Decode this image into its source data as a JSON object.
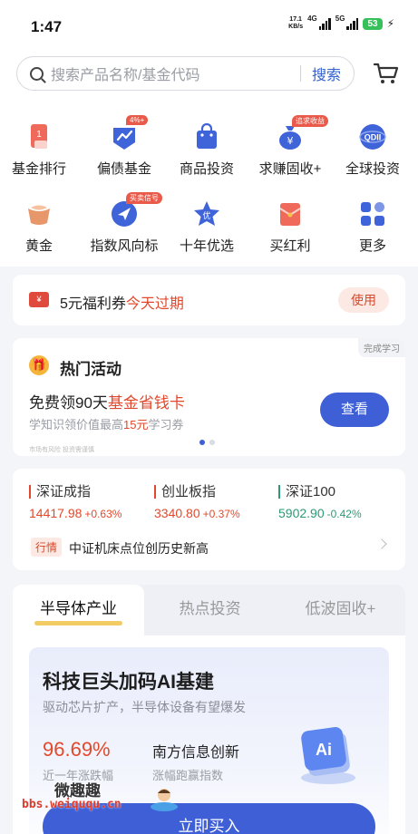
{
  "status_bar": {
    "time": "1:47",
    "speed_value": "17.1",
    "speed_unit": "KB/s",
    "net1": "4G",
    "net2": "5G",
    "battery": "53"
  },
  "search": {
    "placeholder": "搜索产品名称/基金代码",
    "button": "搜索"
  },
  "shortcuts": [
    {
      "label": "基金排行",
      "icon": "ranking-icon"
    },
    {
      "label": "偏债基金",
      "icon": "bond-fund-icon",
      "badge": "4%+"
    },
    {
      "label": "商品投资",
      "icon": "shopping-bag-icon"
    },
    {
      "label": "求赚固收+",
      "icon": "money-bag-icon",
      "badge": "追求收益"
    },
    {
      "label": "全球投资",
      "icon": "qdii-globe-icon"
    },
    {
      "label": "黄金",
      "icon": "gold-icon"
    },
    {
      "label": "指数风向标",
      "icon": "index-compass-icon",
      "badge": "买卖信号"
    },
    {
      "label": "十年优选",
      "icon": "star-quality-icon"
    },
    {
      "label": "买红利",
      "icon": "red-envelope-icon"
    },
    {
      "label": "更多",
      "icon": "more-grid-icon"
    }
  ],
  "coupon": {
    "prefix": "5元福利券",
    "highlight": "今天过期",
    "button": "使用"
  },
  "activity": {
    "corner_tag": "完成学习",
    "title": "热门活动",
    "main_prefix": "免费领90天",
    "main_highlight": "基金省钱卡",
    "sub_prefix": "学知识领价值最高",
    "sub_highlight": "15元",
    "sub_suffix": "学习券",
    "button": "查看",
    "risk": "市场有风险 投资需谨慎"
  },
  "market": {
    "indices": [
      {
        "name": "深证成指",
        "value": "14417.98",
        "change": "+0.63%",
        "trend": "up"
      },
      {
        "name": "创业板指",
        "value": "3340.80",
        "change": "+0.37%",
        "trend": "up"
      },
      {
        "name": "深证100",
        "value": "5902.90",
        "change": "-0.42%",
        "trend": "down"
      }
    ],
    "news_tag": "行情",
    "news_text": "中证机床点位创历史新高"
  },
  "fund_section": {
    "tabs": [
      "半导体产业",
      "热点投资",
      "低波固收+"
    ],
    "active_tab": 0,
    "card": {
      "title": "科技巨头加码AI基建",
      "subtitle": "驱动芯片扩产，半导体设备有望爆发",
      "rate": "96.69%",
      "rate_label": "近一年涨跌幅",
      "fund_name": "南方信息创新",
      "benchmark": "涨幅跑赢指数",
      "button": "立即买入"
    }
  },
  "watermark": {
    "text": "微趣趣",
    "url": "bbs.weiququ.cn"
  },
  "colors": {
    "accent": "#3f5fd6",
    "up": "#e2492c",
    "down": "#2d9a73"
  }
}
